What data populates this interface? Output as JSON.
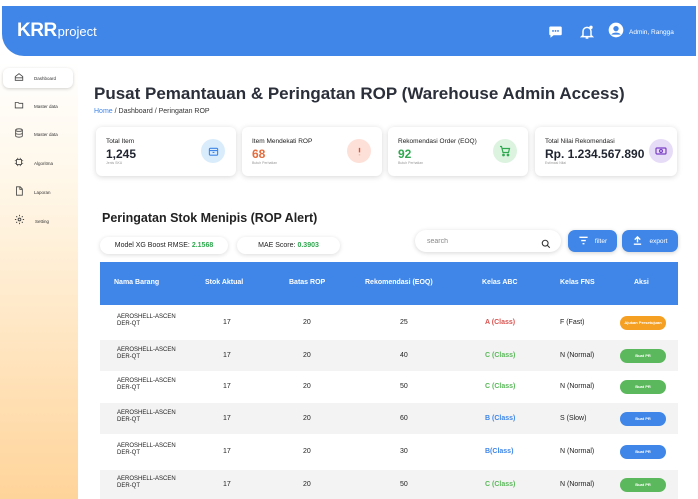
{
  "brand": {
    "strong": "KRR",
    "light": "project"
  },
  "header": {
    "user_label": "Admin, Rangga",
    "icons": [
      "chat-icon",
      "bell-icon",
      "user-avatar-icon"
    ]
  },
  "sidebar": {
    "items": [
      {
        "label": "Dashboard",
        "icon": "home-icon",
        "active": true
      },
      {
        "label": "Master data",
        "icon": "folder-icon"
      },
      {
        "label": "Master data",
        "icon": "database-icon"
      },
      {
        "label": "Algoritma",
        "icon": "chip-icon"
      },
      {
        "label": "Laporan",
        "icon": "document-icon"
      },
      {
        "label": "Setting",
        "icon": "gear-icon"
      }
    ]
  },
  "page": {
    "title": "Pusat Pemantauan & Peringatan ROP  (Warehouse Admin Access)",
    "breadcrumb": {
      "home": "Home",
      "sep1": " / ",
      "item1": "Dashboard",
      "sep2": "  / ",
      "item2": "Peringatan ROP"
    }
  },
  "cards": [
    {
      "title": "Total Item",
      "value": "1,245",
      "note": "Jenis SKU",
      "icon": "box-icon",
      "value_color": "#1f2430",
      "icon_bg": "#d9ecfb",
      "icon_color": "#3f86e8"
    },
    {
      "title": "Item Mendekati ROP",
      "value": "68",
      "note": "Butuh Perhatian",
      "icon": "alert-icon",
      "value_color": "#e46b3c",
      "icon_bg": "#fde0d8",
      "icon_color": "#e0533a"
    },
    {
      "title": "Rekomendasi Order (EOQ)",
      "value": "92",
      "note": "Butuh Perhatian",
      "icon": "cart-icon",
      "value_color": "#2fa84f",
      "icon_bg": "#dcf3df",
      "icon_color": "#2fa84f"
    },
    {
      "title": "Total Nilai Rekomendasi",
      "value": "Rp. 1.234.567.890",
      "note": "Estimasi Nilai",
      "icon": "money-icon",
      "value_color": "#1f2430",
      "icon_bg": "#e7dcf7",
      "icon_color": "#7b3fc7"
    }
  ],
  "alerts": {
    "title": "Peringatan Stok Menipis (ROP Alert)",
    "rmse_label": "Model XG Boost RMSE:",
    "rmse_value": "2.1568",
    "mae_label": "MAE Score:",
    "mae_value": "0.3903",
    "search_placeholder": "search",
    "filter_label": "filter",
    "export_label": "export"
  },
  "table": {
    "columns": [
      "Nama Barang",
      "Stok Aktual",
      "Batas ROP",
      "Rekomendasi (EOQ)",
      "Kelas ABC",
      "Kelas FNS",
      "Aksi"
    ],
    "rows": [
      {
        "name": "AEROSHELL-ASCENDER-QT",
        "stok": "17",
        "rop": "20",
        "eoq": "25",
        "abc": "A (Class)",
        "abc_color": "#d9534f",
        "fns": "F (Fast)",
        "action": "Ajukan Persetujuan",
        "action_color": "#f5a023"
      },
      {
        "name": "AEROSHELL-ASCENDER-QT",
        "stok": "17",
        "rop": "20",
        "eoq": "40",
        "abc": "C (Class)",
        "abc_color": "#5cb85c",
        "fns": "N (Normal)",
        "action": "Buat PR",
        "action_color": "#5cb85c"
      },
      {
        "name": "AEROSHELL-ASCENDER-QT",
        "stok": "17",
        "rop": "20",
        "eoq": "50",
        "abc": "C (Class)",
        "abc_color": "#5cb85c",
        "fns": "N (Normal)",
        "action": "Buat PR",
        "action_color": "#5cb85c"
      },
      {
        "name": "AEROSHELL-ASCENDER-QT",
        "stok": "17",
        "rop": "20",
        "eoq": "60",
        "abc": "B (Class)",
        "abc_color": "#3f86e8",
        "fns": "S (Slow)",
        "action": "Buat PR",
        "action_color": "#3f86e8"
      },
      {
        "name": "AEROSHELL-ASCENDER-QT",
        "stok": "17",
        "rop": "20",
        "eoq": "30",
        "abc": "B(Class)",
        "abc_color": "#3f86e8",
        "fns": "N (Normal)",
        "action": "Buat PR",
        "action_color": "#3f86e8"
      },
      {
        "name": "AEROSHELL-ASCENDER-QT",
        "stok": "17",
        "rop": "20",
        "eoq": "50",
        "abc": "C (Class)",
        "abc_color": "#5cb85c",
        "fns": "N (Normal)",
        "action": "Buat PR",
        "action_color": "#5cb85c"
      }
    ]
  },
  "colors": {
    "primary": "#3f86e8",
    "sidebar_bottom": "#ffd49a"
  }
}
